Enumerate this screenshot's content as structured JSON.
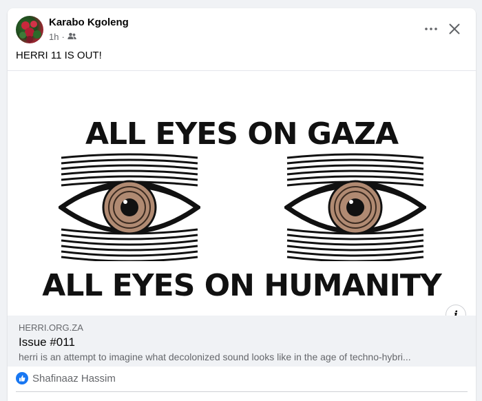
{
  "post": {
    "author": "Karabo Kgoleng",
    "time": "1h",
    "separator": "·",
    "audience_icon": "friends-icon",
    "text": "HERRI 11 IS OUT!"
  },
  "header_actions": {
    "more_icon": "more-options-icon",
    "close_icon": "close-icon"
  },
  "image": {
    "headline_top": "ALL EYES ON GAZA",
    "headline_bottom": "ALL EYES ON HUMANITY",
    "info_glyph": "i"
  },
  "link_preview": {
    "domain": "HERRI.ORG.ZA",
    "title": "Issue #011",
    "description": "herri is an attempt to imagine what decolonized sound looks like in the age of techno-hybri..."
  },
  "reactions": {
    "icon": "like-icon",
    "label": "Shafinaaz Hassim"
  },
  "colors": {
    "accent": "#1877f2",
    "secondary_text": "#65676b",
    "background": "#f0f2f5"
  }
}
